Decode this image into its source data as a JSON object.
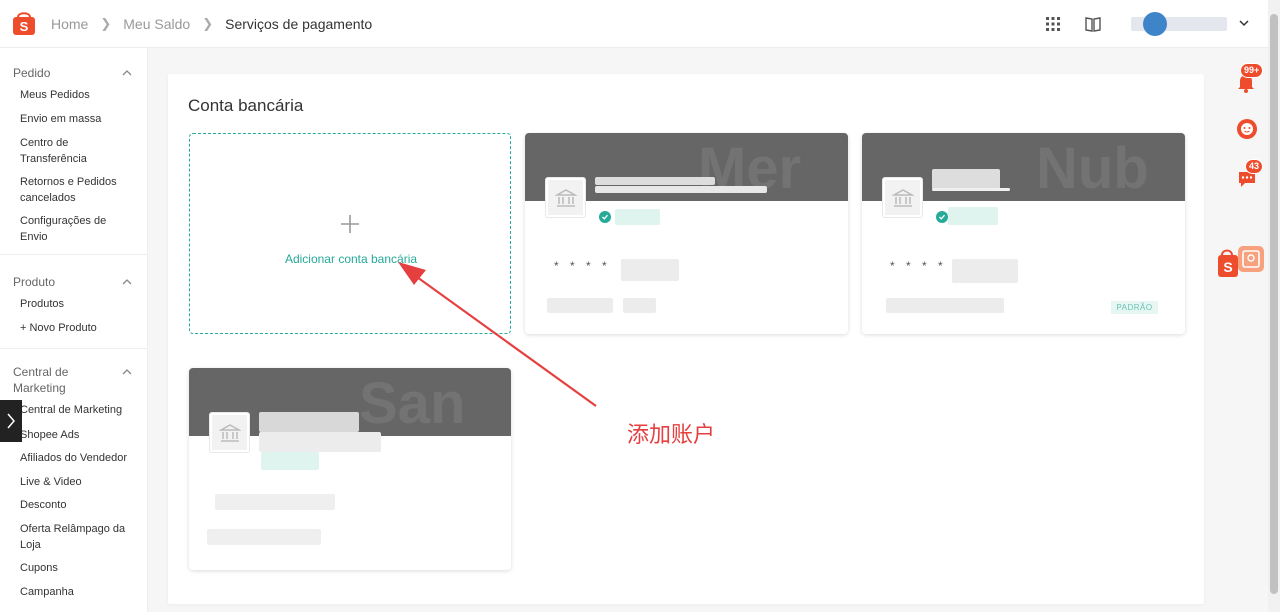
{
  "header": {
    "breadcrumbs": [
      "Home",
      "Meu Saldo",
      "Serviços de pagamento"
    ],
    "icons": [
      "apps-grid-icon",
      "book-icon",
      "chevron-down-icon"
    ]
  },
  "sidebar": {
    "sections": [
      {
        "title": "Pedido",
        "items": [
          "Meus Pedidos",
          "Envio em massa",
          "Centro de Transferência",
          "Retornos e Pedidos cancelados",
          "Configurações de Envio"
        ]
      },
      {
        "title": "Produto",
        "items": [
          "Produtos",
          "+ Novo Produto"
        ]
      },
      {
        "title": "Central de Marketing",
        "items": [
          "Central de Marketing",
          "Shopee Ads",
          "Afiliados do Vendedor",
          "Live & Video",
          "Desconto",
          "Oferta Relâmpago da Loja",
          "Cupons",
          "Campanha"
        ]
      }
    ]
  },
  "main": {
    "title": "Conta bancária",
    "add_label": "Adicionar conta bancária",
    "cards": [
      {
        "watermark": "Mer",
        "masked": "* * * *",
        "default_badge": ""
      },
      {
        "watermark": "Nub",
        "masked": "* * * *",
        "default_badge": "PADRÃO"
      },
      {
        "watermark": "San",
        "masked": "",
        "default_badge": ""
      }
    ]
  },
  "annotation": {
    "text": "添加账户",
    "color": "#e5403f"
  },
  "floating": {
    "notifications_badge": "99+",
    "chat_badge": "43"
  },
  "colors": {
    "brand": "#ee4d2d",
    "accent": "#26aa99",
    "card_band": "#666666"
  }
}
